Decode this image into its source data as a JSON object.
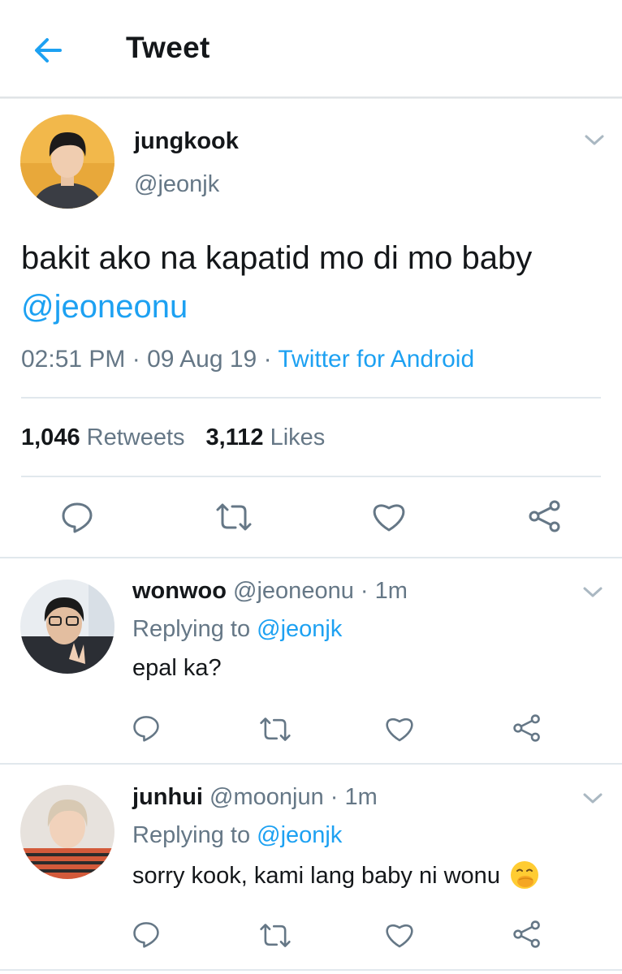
{
  "header": {
    "title": "Tweet",
    "back_icon": "arrow-left-icon"
  },
  "main_tweet": {
    "name": "jungkook",
    "handle": "@jeonjk",
    "text_before": "bakit ako na kapatid mo di mo baby ",
    "mention": "@jeoneonu",
    "time": "02:51 PM",
    "sep1": " · ",
    "date": "09 Aug 19",
    "sep2": " · ",
    "source": "Twitter for Android",
    "retweets_count": "1,046",
    "retweets_label": "Retweets",
    "likes_count": "3,112",
    "likes_label": "Likes"
  },
  "replies": [
    {
      "name": "wonwoo",
      "handle": "@jeoneonu",
      "time": "· 1m",
      "replying_prefix": "Replying to ",
      "replying_to": "@jeonjk",
      "text": "epal ka?"
    },
    {
      "name": "junhui",
      "handle": "@moonjun",
      "time": "· 1m",
      "replying_prefix": "Replying to ",
      "replying_to": "@jeonjk",
      "text": "sorry kook, kami lang baby ni wonu",
      "emoji": "face-with-hand-over-mouth-emoji"
    }
  ],
  "colors": {
    "accent": "#1da1f2",
    "muted": "#657786",
    "text": "#14171a",
    "divider": "#e1e8ed",
    "emoji": "#ffcc33"
  }
}
